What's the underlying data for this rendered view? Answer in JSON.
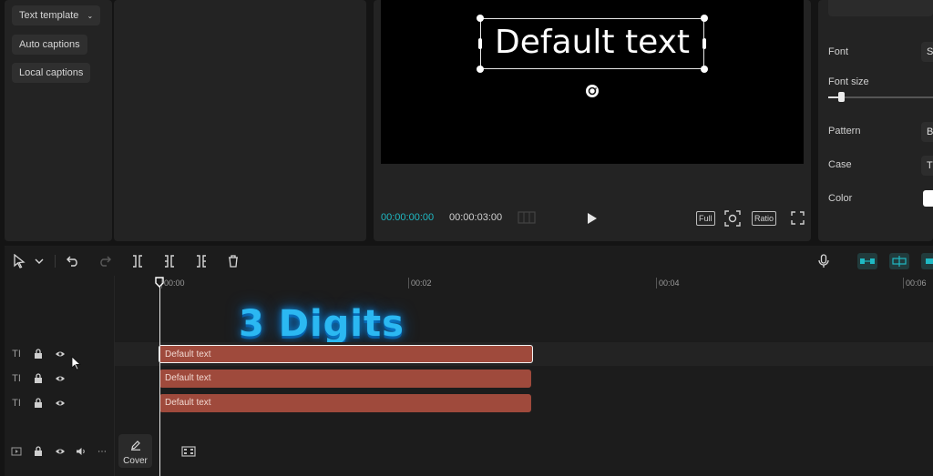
{
  "left_panel": {
    "buttons": [
      {
        "label": "Text template"
      },
      {
        "label": "Auto captions"
      },
      {
        "label": "Local captions"
      }
    ]
  },
  "player": {
    "overlay_text": "Default text",
    "time_current": "00:00:00:00",
    "time_total": "00:00:03:00",
    "full_label": "Full",
    "ratio_label": "Ratio",
    "accent_color": "#1fb9c3"
  },
  "properties": {
    "font_label": "Font",
    "font_value": "S",
    "font_size_label": "Font size",
    "font_size_level": 0.12,
    "pattern_label": "Pattern",
    "pattern_value": "B",
    "case_label": "Case",
    "case_value": "T",
    "color_label": "Color",
    "color_value": "#ffffff"
  },
  "timeline": {
    "ruler": [
      "00:00",
      "00:02",
      "00:04",
      "00:06"
    ],
    "overlay_title": "3 Digits",
    "tracks": [
      {
        "clip_label": "Default text",
        "selected": true
      },
      {
        "clip_label": "Default text",
        "selected": false
      },
      {
        "clip_label": "Default text",
        "selected": false
      }
    ],
    "cover_label": "Cover"
  }
}
